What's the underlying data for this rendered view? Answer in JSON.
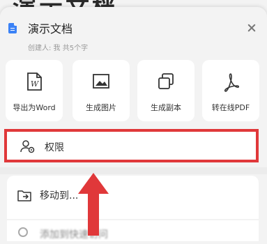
{
  "background": {
    "doc_title": "演示文档"
  },
  "header": {
    "title": "演示文档",
    "subtitle": "创建人: 我   共5个字",
    "icons": {
      "doc": "document-icon",
      "close": "close-icon"
    }
  },
  "actions": [
    {
      "label": "导出为Word",
      "icon": "word-icon"
    },
    {
      "label": "生成图片",
      "icon": "image-icon"
    },
    {
      "label": "生成副本",
      "icon": "copy-icon"
    },
    {
      "label": "转在线PDF",
      "icon": "pdf-icon"
    }
  ],
  "menu": {
    "permission": {
      "label": "权限",
      "icon": "user-settings-icon"
    },
    "move": {
      "label": "移动到...",
      "icon": "folder-move-icon"
    },
    "next": {
      "label": "添加到快速访问",
      "icon": "circle-icon"
    }
  },
  "annotation": {
    "highlight_color": "#e0383a",
    "arrow_color": "#e0383a"
  },
  "colors": {
    "accent": "#3b82f6"
  }
}
